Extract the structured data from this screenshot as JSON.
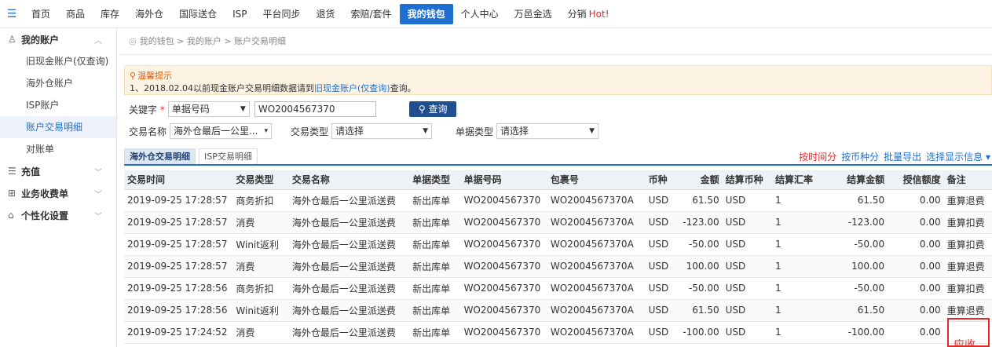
{
  "topnav": {
    "items": [
      "首页",
      "商品",
      "库存",
      "海外仓",
      "国际送仓",
      "ISP",
      "平台同步",
      "退货",
      "索赔/套件",
      "我的钱包",
      "个人中心",
      "万邑金选",
      "分销"
    ],
    "hot": "Hot!"
  },
  "sidebar": {
    "account_title": "我的账户",
    "items": [
      "旧现金账户(仅查询)",
      "海外仓账户",
      "ISP账户",
      "账户交易明细",
      "对账单"
    ],
    "recharge": "充值",
    "business": "业务收费单",
    "personal": "个性化设置"
  },
  "breadcrumb": "我的钱包 > 我的账户 > 账户交易明细",
  "notice": {
    "title": "温馨提示",
    "line_prefix": "1、2018.02.04以前现金账户交易明细数据请到",
    "line_link": "旧现金账户(仅查询)",
    "line_suffix": "查询。"
  },
  "filters": {
    "keyword_label": "关键字",
    "keyword_type": "单据号码",
    "keyword_value": "WO2004567370",
    "query_button": "查询",
    "trade_name_label": "交易名称",
    "trade_name_value": "海外仓最后一公里...",
    "trade_type_label": "交易类型",
    "trade_type_value": "请选择",
    "doc_type_label": "单据类型",
    "doc_type_value": "请选择"
  },
  "tabs": [
    "海外仓交易明细",
    "ISP交易明细"
  ],
  "tab_actions": {
    "by_time": "按时间分",
    "by_currency": "按币种分",
    "batch": "批量导出",
    "display": "选择显示信息"
  },
  "table": {
    "headers": [
      "交易时间",
      "交易类型",
      "交易名称",
      "单据类型",
      "单据号码",
      "包裹号",
      "币种",
      "金额",
      "结算币种",
      "结算汇率",
      "结算金额",
      "授信额度",
      "备注"
    ],
    "rows": [
      [
        "2019-09-25 17:28:57",
        "商务折扣",
        "海外仓最后一公里派送费",
        "新出库单",
        "WO2004567370",
        "WO2004567370A",
        "USD",
        "61.50",
        "USD",
        "1",
        "61.50",
        "0.00",
        "重算退费"
      ],
      [
        "2019-09-25 17:28:57",
        "消费",
        "海外仓最后一公里派送费",
        "新出库单",
        "WO2004567370",
        "WO2004567370A",
        "USD",
        "-123.00",
        "USD",
        "1",
        "-123.00",
        "0.00",
        "重算扣费"
      ],
      [
        "2019-09-25 17:28:57",
        "Winit返利",
        "海外仓最后一公里派送费",
        "新出库单",
        "WO2004567370",
        "WO2004567370A",
        "USD",
        "-50.00",
        "USD",
        "1",
        "-50.00",
        "0.00",
        "重算扣费"
      ],
      [
        "2019-09-25 17:28:57",
        "消费",
        "海外仓最后一公里派送费",
        "新出库单",
        "WO2004567370",
        "WO2004567370A",
        "USD",
        "100.00",
        "USD",
        "1",
        "100.00",
        "0.00",
        "重算退费"
      ],
      [
        "2019-09-25 17:28:56",
        "商务折扣",
        "海外仓最后一公里派送费",
        "新出库单",
        "WO2004567370",
        "WO2004567370A",
        "USD",
        "-50.00",
        "USD",
        "1",
        "-50.00",
        "0.00",
        "重算扣费"
      ],
      [
        "2019-09-25 17:28:56",
        "Winit返利",
        "海外仓最后一公里派送费",
        "新出库单",
        "WO2004567370",
        "WO2004567370A",
        "USD",
        "61.50",
        "USD",
        "1",
        "61.50",
        "0.00",
        "重算退费"
      ],
      [
        "2019-09-25 17:24:52",
        "消费",
        "海外仓最后一公里派送费",
        "新出库单",
        "WO2004567370",
        "WO2004567370A",
        "USD",
        "-100.00",
        "USD",
        "1",
        "-100.00",
        "0.00",
        ""
      ]
    ]
  },
  "annotation": "应收",
  "colors": {
    "accent": "#1f6fd1",
    "danger": "#e02b2b",
    "notice_bg": "#fdf3e3"
  }
}
